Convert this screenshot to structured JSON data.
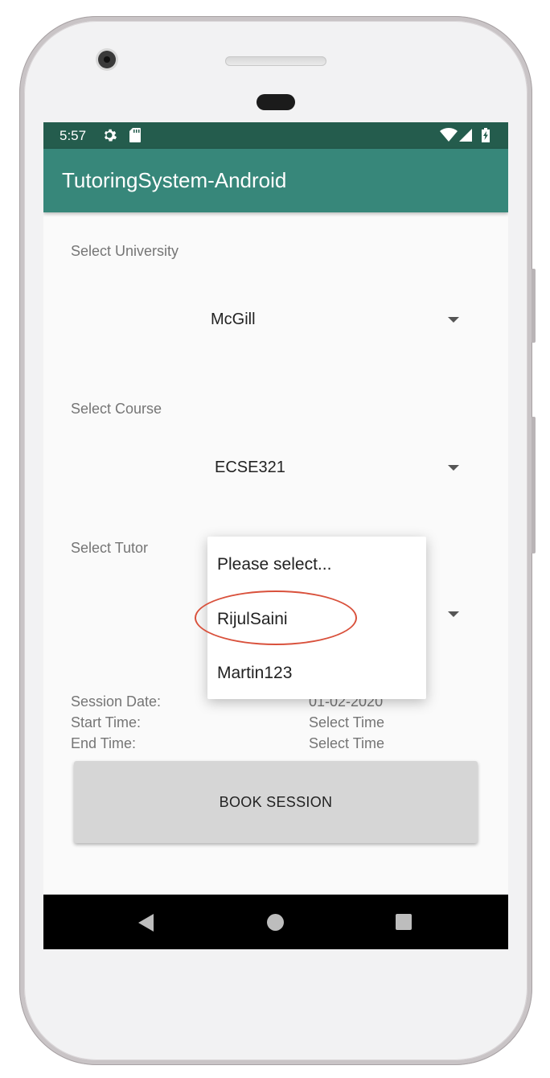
{
  "status_bar": {
    "time": "5:57",
    "icons": [
      "gear-icon",
      "sd-card-icon",
      "wifi-icon",
      "signal-icon",
      "battery-charging-icon"
    ]
  },
  "app_bar": {
    "title": "TutoringSystem-Android"
  },
  "university": {
    "label": "Select University",
    "selected": "McGill"
  },
  "course": {
    "label": "Select Course",
    "selected": "ECSE321"
  },
  "tutor": {
    "label": "Select Tutor",
    "dropdown_options": [
      "Please select...",
      "RijulSaini",
      "Martin123"
    ],
    "highlighted_option": "RijulSaini"
  },
  "session": {
    "date_label": "Session Date:",
    "date_value": "01-02-2020",
    "start_label": "Start Time:",
    "start_value": "Select Time",
    "end_label": "End Time:",
    "end_value": "Select Time"
  },
  "book_button": "BOOK SESSION",
  "colors": {
    "status_bar": "#245c4d",
    "app_bar": "#37877a",
    "annotation": "#d9513c"
  },
  "nav_bar": {
    "icons": [
      "back-icon",
      "home-icon",
      "recents-icon"
    ]
  }
}
